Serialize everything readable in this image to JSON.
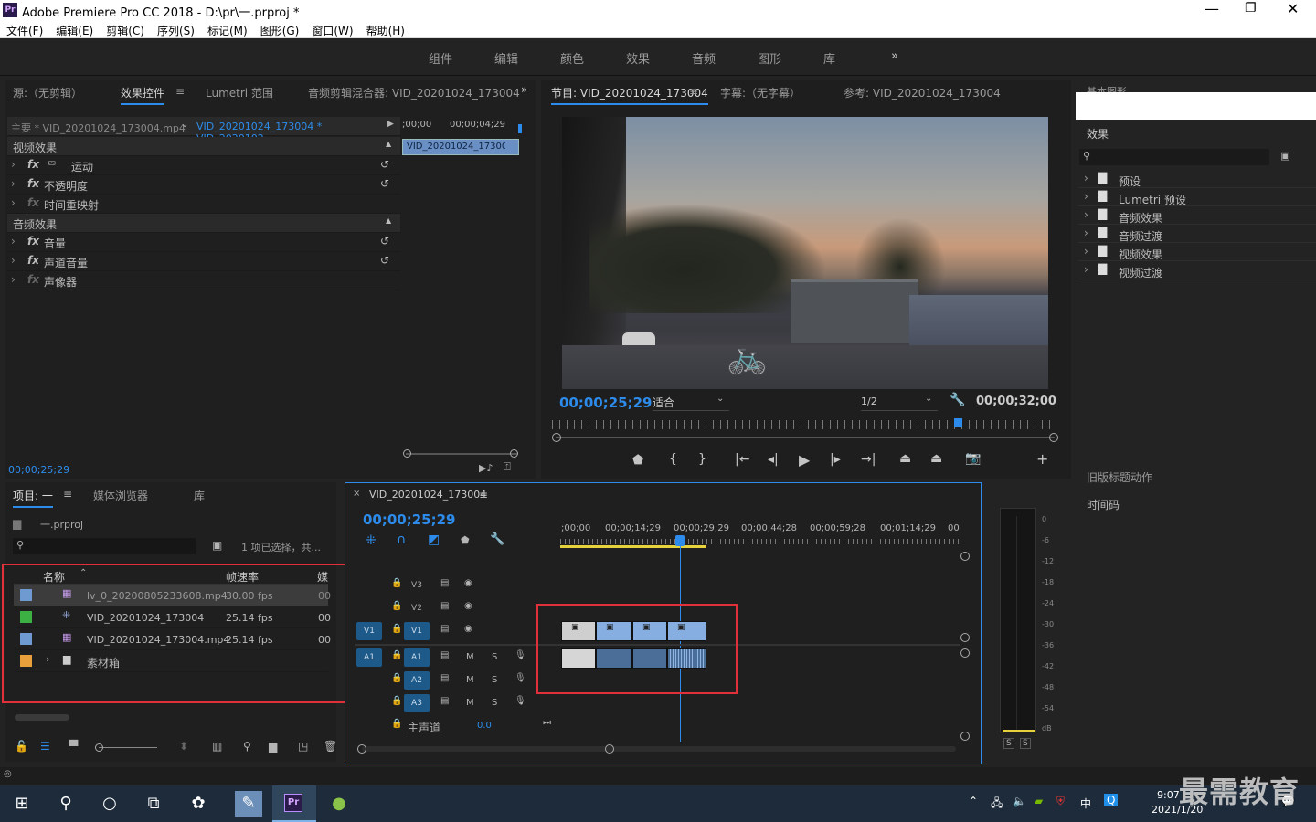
{
  "window": {
    "title": "Adobe Premiere Pro CC 2018 - D:\\pr\\一.prproj *",
    "app_icon": "Pr"
  },
  "menu": [
    "文件(F)",
    "编辑(E)",
    "剪辑(C)",
    "序列(S)",
    "标记(M)",
    "图形(G)",
    "窗口(W)",
    "帮助(H)"
  ],
  "workspaces": [
    "组件",
    "编辑",
    "颜色",
    "效果",
    "音频",
    "图形",
    "库"
  ],
  "source_panel": {
    "tabs": [
      "源:（无剪辑）",
      "效果控件",
      "Lumetri 范围",
      "音频剪辑混合器: VID_20201024_173004"
    ],
    "master": "主要 * VID_20201024_173004.mp4",
    "sequence_clip": "VID_20201024_173004 * VID_2020102...",
    "ruler_start": ";00;00",
    "ruler_end": "00;00;04;29",
    "clip_label": "VID_20201024_173004",
    "video_effects": "视频效果",
    "audio_effects": "音频效果",
    "effects": [
      "运动",
      "不透明度",
      "时间重映射",
      "音量",
      "声道音量",
      "声像器"
    ],
    "timecode": "00;00;25;29"
  },
  "program_panel": {
    "tabs": [
      "节目: VID_20201024_173004",
      "字幕:（无字幕）",
      "参考: VID_20201024_173004"
    ],
    "timecode": "00;00;25;29",
    "fit": "适合",
    "resolution": "1/2",
    "duration": "00;00;32;00"
  },
  "effects_panel": {
    "header": "基本图形",
    "title": "效果",
    "items": [
      "预设",
      "Lumetri 预设",
      "音频效果",
      "音频过渡",
      "视频效果",
      "视频过渡"
    ],
    "legacy": "旧版标题动作",
    "timecode_label": "时间码"
  },
  "project_panel": {
    "tabs": [
      "项目: 一",
      "媒体浏览器",
      "库"
    ],
    "project_file": "一.prproj",
    "selection_info": "1 项已选择，共...",
    "col_name": "名称",
    "col_fps": "帧速率",
    "col_media": "媒",
    "rows": [
      {
        "name": "lv_0_20200805233608.mp4",
        "fps": "30.00 fps",
        "media": "00",
        "color": "#6f9ad1"
      },
      {
        "name": "VID_20201024_173004",
        "fps": "25.14 fps",
        "media": "00",
        "color": "#3cb043"
      },
      {
        "name": "VID_20201024_173004.mp4",
        "fps": "25.14 fps",
        "media": "00",
        "color": "#6f9ad1"
      },
      {
        "name": "素材箱",
        "fps": "",
        "media": "",
        "color": "#e8a03c"
      }
    ]
  },
  "timeline": {
    "tab": "VID_20201024_173004",
    "timecode": "00;00;25;29",
    "ruler": [
      ";00;00",
      "00;00;14;29",
      "00;00;29;29",
      "00;00;44;28",
      "00;00;59;28",
      "00;01;14;29",
      "00"
    ],
    "video_tracks": [
      "V3",
      "V2",
      "V1"
    ],
    "audio_tracks": [
      "A1",
      "A2",
      "A3"
    ],
    "src_v": "V1",
    "src_a": "A1",
    "master": "主声道",
    "master_value": "0.0",
    "mute": "M",
    "solo": "S"
  },
  "meter": {
    "labels": [
      "0",
      "-6",
      "-12",
      "-18",
      "-24",
      "-30",
      "-36",
      "-42",
      "-48",
      "-54",
      "dB"
    ],
    "solo": "S"
  },
  "taskbar": {
    "time": "9:07",
    "date": "2021/1/20",
    "ime": "中"
  },
  "watermark": "最需教育"
}
